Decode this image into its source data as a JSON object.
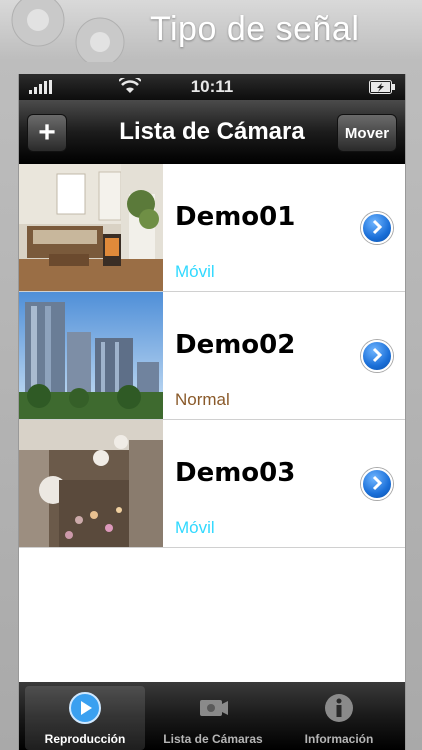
{
  "banner": {
    "title": "Tipo de señal"
  },
  "status": {
    "time": "10:11"
  },
  "nav": {
    "title": "Lista de Cámara",
    "add_label": "+",
    "move_label": "Mover"
  },
  "cameras": [
    {
      "name": "Demo01",
      "type": "Móvil",
      "type_color": "#31d9ff",
      "thumb": "living-room"
    },
    {
      "name": "Demo02",
      "type": "Normal",
      "type_color": "#8a5a2a",
      "thumb": "skyscrapers"
    },
    {
      "name": "Demo03",
      "type": "Móvil",
      "type_color": "#31d9ff",
      "thumb": "mall-atrium"
    }
  ],
  "tabs": [
    {
      "label": "Reproducción",
      "icon": "playback-icon",
      "active": true
    },
    {
      "label": "Lista de Cámaras",
      "icon": "cameras-icon",
      "active": false
    },
    {
      "label": "Información",
      "icon": "info-icon",
      "active": false
    }
  ],
  "colors": {
    "accent_blue": "#1a6fd8",
    "mobile_cyan": "#31d9ff",
    "normal_brown": "#8a5a2a"
  }
}
